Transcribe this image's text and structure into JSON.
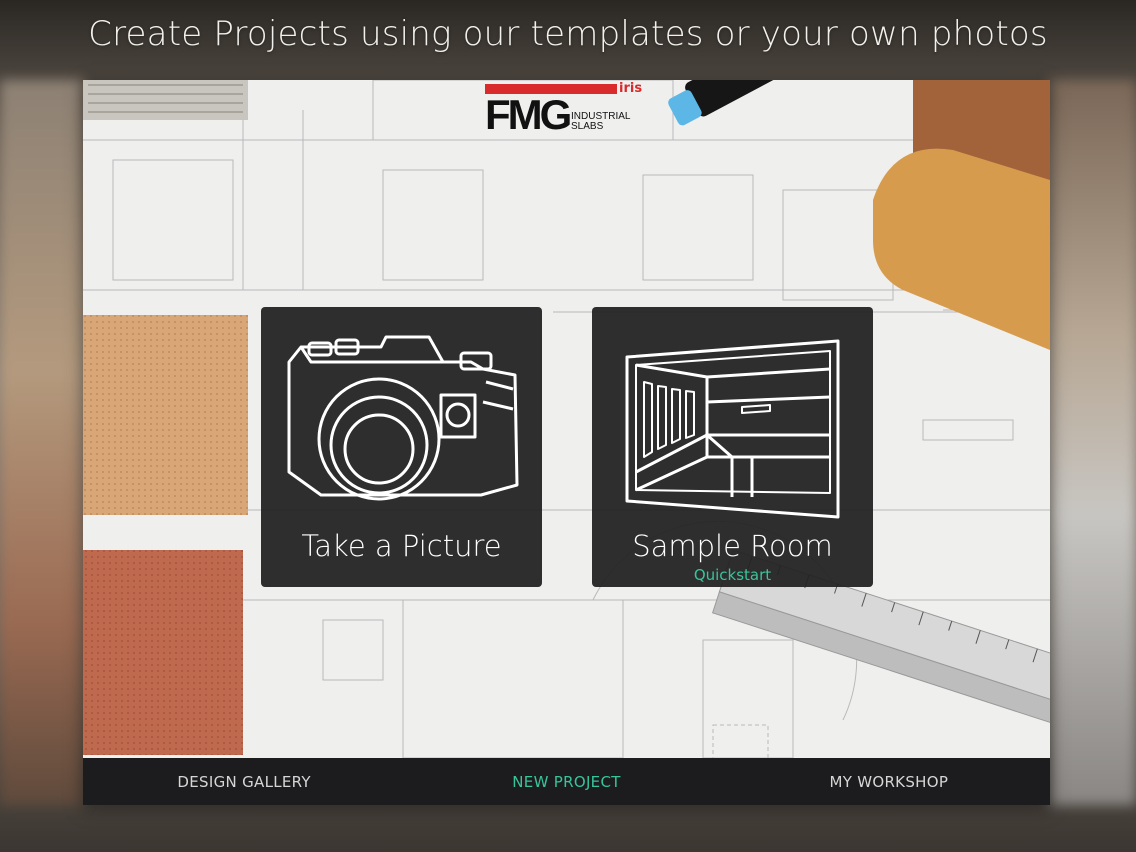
{
  "headline": "Create Projects using our templates or your own photos",
  "logo": {
    "brand": "FMG",
    "mark": "iris",
    "line1": "INDUSTRIAL",
    "line2": "SLABS"
  },
  "cards": [
    {
      "label": "Take a Picture",
      "subtitle": "",
      "icon": "camera-icon"
    },
    {
      "label": "Sample Room",
      "subtitle": "Quickstart",
      "icon": "room-icon"
    }
  ],
  "tabs": [
    {
      "label": "DESIGN GALLERY",
      "active": false
    },
    {
      "label": "NEW PROJECT",
      "active": true
    },
    {
      "label": "MY WORKSHOP",
      "active": false
    }
  ],
  "colors": {
    "accent": "#37c59a",
    "card_bg": "#222222",
    "tabbar_bg": "#1c1c1e",
    "logo_red": "#d92b2b"
  }
}
